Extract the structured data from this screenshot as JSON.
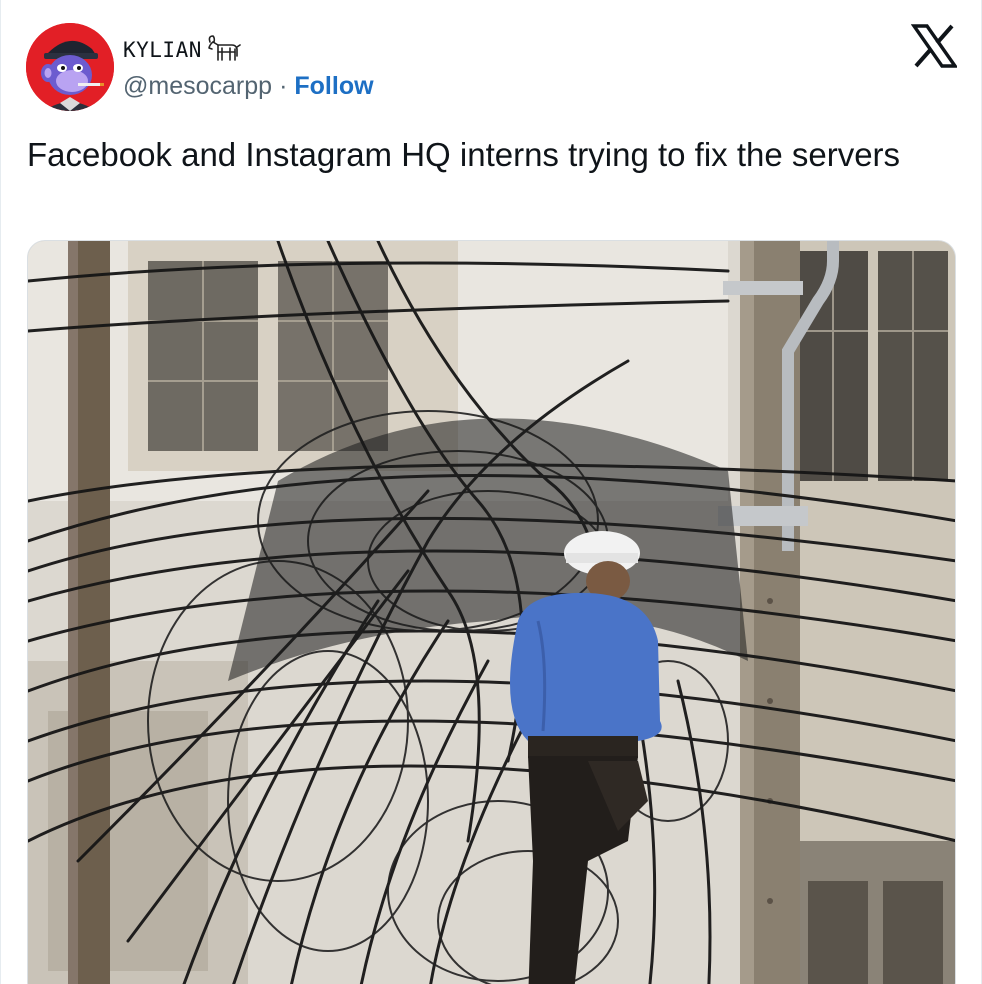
{
  "user": {
    "display_name": "KYLIAN",
    "handle": "@mesocarpp",
    "separator": "·",
    "follow_label": "Follow",
    "name_badge_icon": "goat-icon",
    "avatar_icon": "ape-avatar-icon"
  },
  "header": {
    "platform_icon": "x-logo-icon"
  },
  "tweet": {
    "text": "Facebook and Instagram HQ interns trying to fix the servers"
  },
  "media": {
    "kind": "photo"
  },
  "colors": {
    "follow": "#1d6fc4",
    "text": "#0f1419",
    "muted": "#536471",
    "avatar_bg": "#e21f26"
  }
}
